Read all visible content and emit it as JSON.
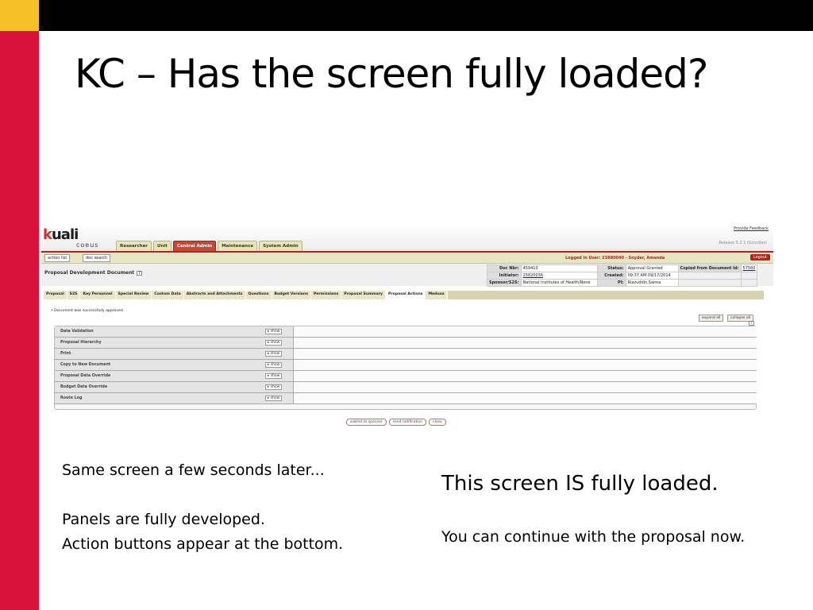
{
  "slide": {
    "title": "KC – Has the screen fully loaded?",
    "left_text": {
      "line1": "Same screen a few seconds later...",
      "line2": "Panels are fully developed.",
      "line3": "Action buttons appear at the bottom."
    },
    "right_text": {
      "heading": "This screen IS fully loaded.",
      "body": "You can continue with the proposal now."
    },
    "colors": {
      "top_bar": "#000000",
      "corner": "#f5c028",
      "left_bar": "#d8123a"
    }
  },
  "app": {
    "logo": "kuali",
    "logo_sub": "coeus",
    "feedback_link": "Provide Feedback",
    "release": "Release 5.2.1 (Grizzlies)",
    "top_tabs": [
      {
        "label": "Researcher"
      },
      {
        "label": "Unit"
      },
      {
        "label": "Central Admin",
        "active": true
      },
      {
        "label": "Maintenance"
      },
      {
        "label": "System Admin"
      }
    ],
    "toolbar": {
      "action_list": "action list",
      "doc_search": "doc search",
      "logged_in": "Logged in User: 23880040 - Snyder, Amanda",
      "logout": "Logout"
    },
    "document": {
      "title": "Proposal Development Document",
      "help": "?",
      "info": {
        "doc_nbr_label": "Doc Nbr:",
        "doc_nbr": "459410",
        "status_label": "Status:",
        "status": "Approval Granted",
        "copied_label": "Copied from Document Id:",
        "copied": "57560",
        "initiator_label": "Initiator:",
        "initiator": "25820036",
        "created_label": "Created:",
        "created": "09:37 AM 09/17/2014",
        "sponsor_label": "Sponsor/S2S:",
        "sponsor": "National Institutes of Health/None",
        "pi_label": "PI:",
        "pi": "Riazuddin,Saima"
      }
    },
    "sub_tabs": [
      {
        "label": "Proposal"
      },
      {
        "label": "S2S"
      },
      {
        "label": "Key Personnel"
      },
      {
        "label": "Special Review"
      },
      {
        "label": "Custom Data"
      },
      {
        "label": "Abstracts and Attachments"
      },
      {
        "label": "Questions"
      },
      {
        "label": "Budget Versions"
      },
      {
        "label": "Permissions"
      },
      {
        "label": "Proposal Summary"
      },
      {
        "label": "Proposal Actions",
        "active": true
      },
      {
        "label": "Medusa"
      }
    ],
    "message": "Document was successfully approved.",
    "expand_all": "expand all",
    "collapse_all": "collapse all",
    "panels": [
      {
        "name": "Data Validation",
        "show": "show"
      },
      {
        "name": "Proposal Hierarchy",
        "show": "show"
      },
      {
        "name": "Print",
        "show": "show"
      },
      {
        "name": "Copy to New Document",
        "show": "show"
      },
      {
        "name": "Proposal Data Override",
        "show": "show"
      },
      {
        "name": "Budget Data Override",
        "show": "show"
      },
      {
        "name": "Route Log",
        "show": "show"
      }
    ],
    "actions": {
      "submit": "submit to sponsor",
      "notify": "send notification",
      "close": "close"
    }
  }
}
